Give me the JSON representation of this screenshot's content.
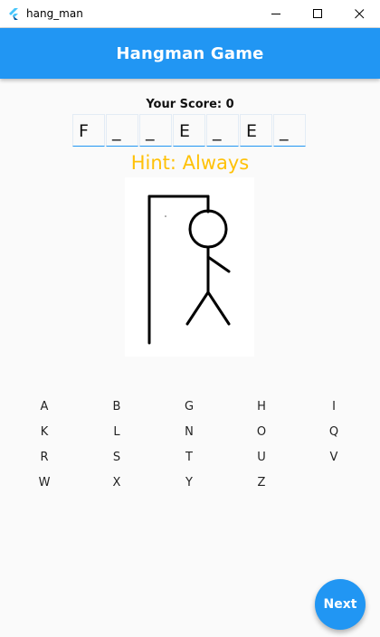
{
  "window": {
    "title": "hang_man"
  },
  "appbar": {
    "title": "Hangman Game"
  },
  "score": {
    "label": "Your Score: 0"
  },
  "word": {
    "letters": [
      "F",
      "_",
      "_",
      "E",
      "_",
      "E",
      "_"
    ]
  },
  "hint": {
    "text": "Hint: Always"
  },
  "keyboard": {
    "rows": [
      [
        "A",
        "B",
        "G",
        "H",
        "I"
      ],
      [
        "K",
        "L",
        "N",
        "O",
        "Q"
      ],
      [
        "R",
        "S",
        "T",
        "U",
        "V"
      ],
      [
        "W",
        "X",
        "Y",
        "Z"
      ]
    ]
  },
  "fab": {
    "label": "Next"
  },
  "colors": {
    "primary": "#2196f3",
    "hint": "#ffc107",
    "background": "#fafafa"
  },
  "icons": {
    "app": "flutter-logo-icon",
    "minimize": "minimize-icon",
    "maximize": "maximize-icon",
    "close": "close-icon"
  }
}
